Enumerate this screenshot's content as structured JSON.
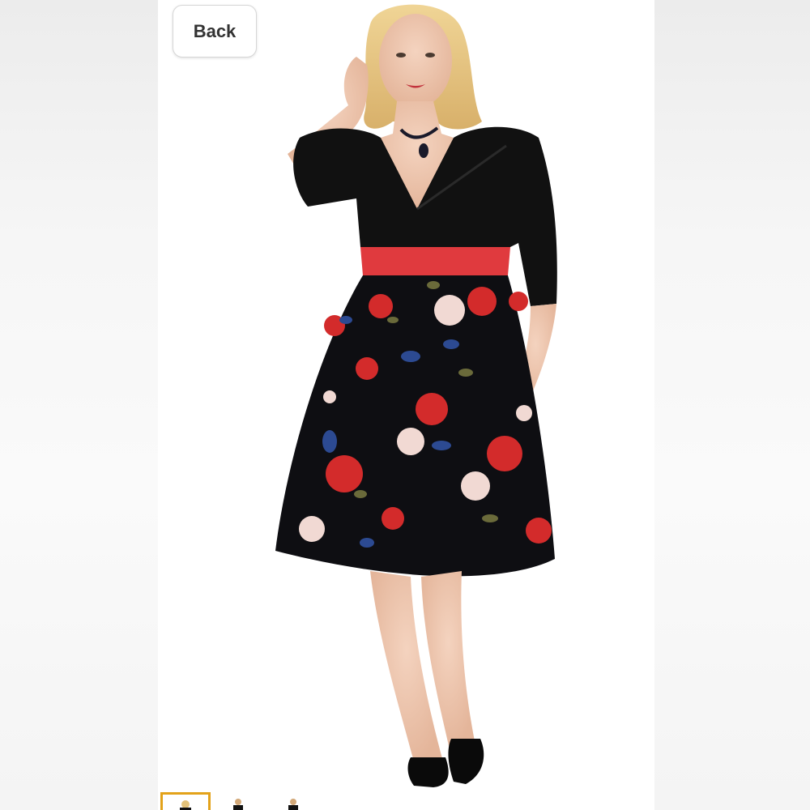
{
  "toolbar": {
    "back_label": "Back"
  },
  "thumbnails": {
    "count": 3,
    "selected_index": 0
  },
  "colors": {
    "selected_thumb_border": "#e3a21a",
    "dress_top": "#111111",
    "sash": "#e03a3e"
  }
}
